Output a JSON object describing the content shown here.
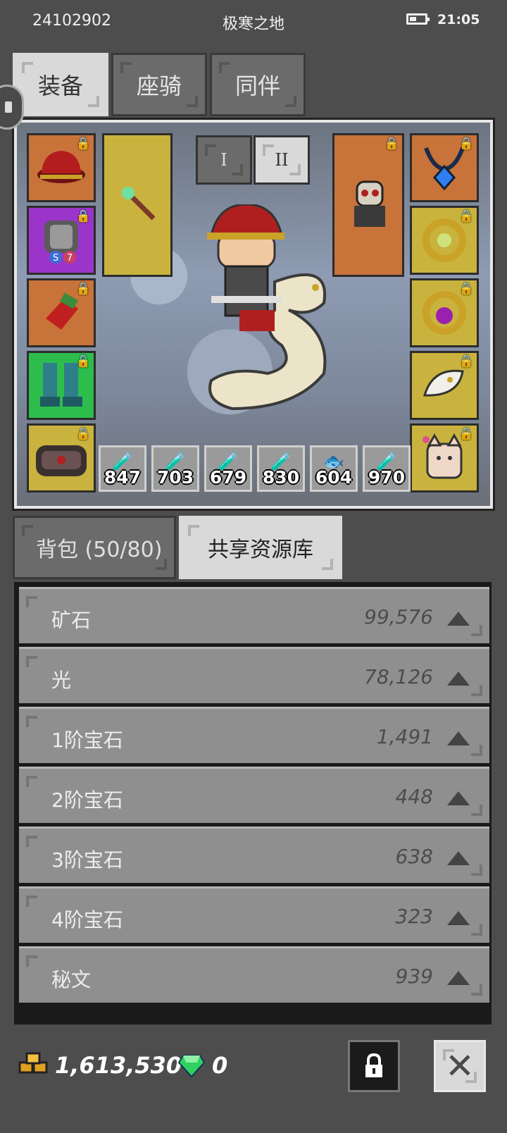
{
  "status_bar": {
    "id": "24102902",
    "title": "极寒之地",
    "time": "21:05"
  },
  "top_tabs": [
    {
      "label": "装备",
      "active": true
    },
    {
      "label": "座骑",
      "active": false
    },
    {
      "label": "同伴",
      "active": false
    }
  ],
  "equipment": {
    "set_buttons": [
      "I",
      "II"
    ],
    "left_slots": [
      {
        "icon": "red-helmet",
        "rarity": "orange"
      },
      {
        "icon": "armor",
        "rarity": "purple"
      },
      {
        "icon": "red-gloves",
        "rarity": "orange"
      },
      {
        "icon": "teal-boots",
        "rarity": "green"
      },
      {
        "icon": "backpack",
        "rarity": "gold"
      }
    ],
    "right_slots": [
      {
        "icon": "blue-amulet",
        "rarity": "orange"
      },
      {
        "icon": "green-ring",
        "rarity": "gold"
      },
      {
        "icon": "purple-ring",
        "rarity": "gold"
      },
      {
        "icon": "white-talisman",
        "rarity": "gold"
      },
      {
        "icon": "lucky-cat",
        "rarity": "gold"
      }
    ],
    "weapon": {
      "icon": "green-wand",
      "rarity": "gold"
    },
    "offhand": {
      "icon": "skull-totem",
      "rarity": "orange"
    },
    "consumables": [
      {
        "icon": "potion",
        "count": "847"
      },
      {
        "icon": "potion",
        "count": "703"
      },
      {
        "icon": "potion",
        "count": "679"
      },
      {
        "icon": "potion",
        "count": "830"
      },
      {
        "icon": "fish",
        "count": "604"
      },
      {
        "icon": "potion",
        "count": "970"
      }
    ]
  },
  "inventory_tabs": [
    {
      "label": "背包 (50/80)",
      "active": false
    },
    {
      "label": "共享资源库",
      "active": true
    }
  ],
  "resources": [
    {
      "name": "矿石",
      "value": "99,576"
    },
    {
      "name": "光",
      "value": "78,126"
    },
    {
      "name": "1阶宝石",
      "value": "1,491"
    },
    {
      "name": "2阶宝石",
      "value": "448"
    },
    {
      "name": "3阶宝石",
      "value": "638"
    },
    {
      "name": "4阶宝石",
      "value": "323"
    },
    {
      "name": "秘文",
      "value": "939"
    }
  ],
  "footer": {
    "gold": "1,613,530",
    "gems": "0"
  },
  "colors": {
    "orange": "#c8733a",
    "purple": "#9b35c9",
    "green": "#2dbd4d",
    "gold": "#c9b33e"
  }
}
